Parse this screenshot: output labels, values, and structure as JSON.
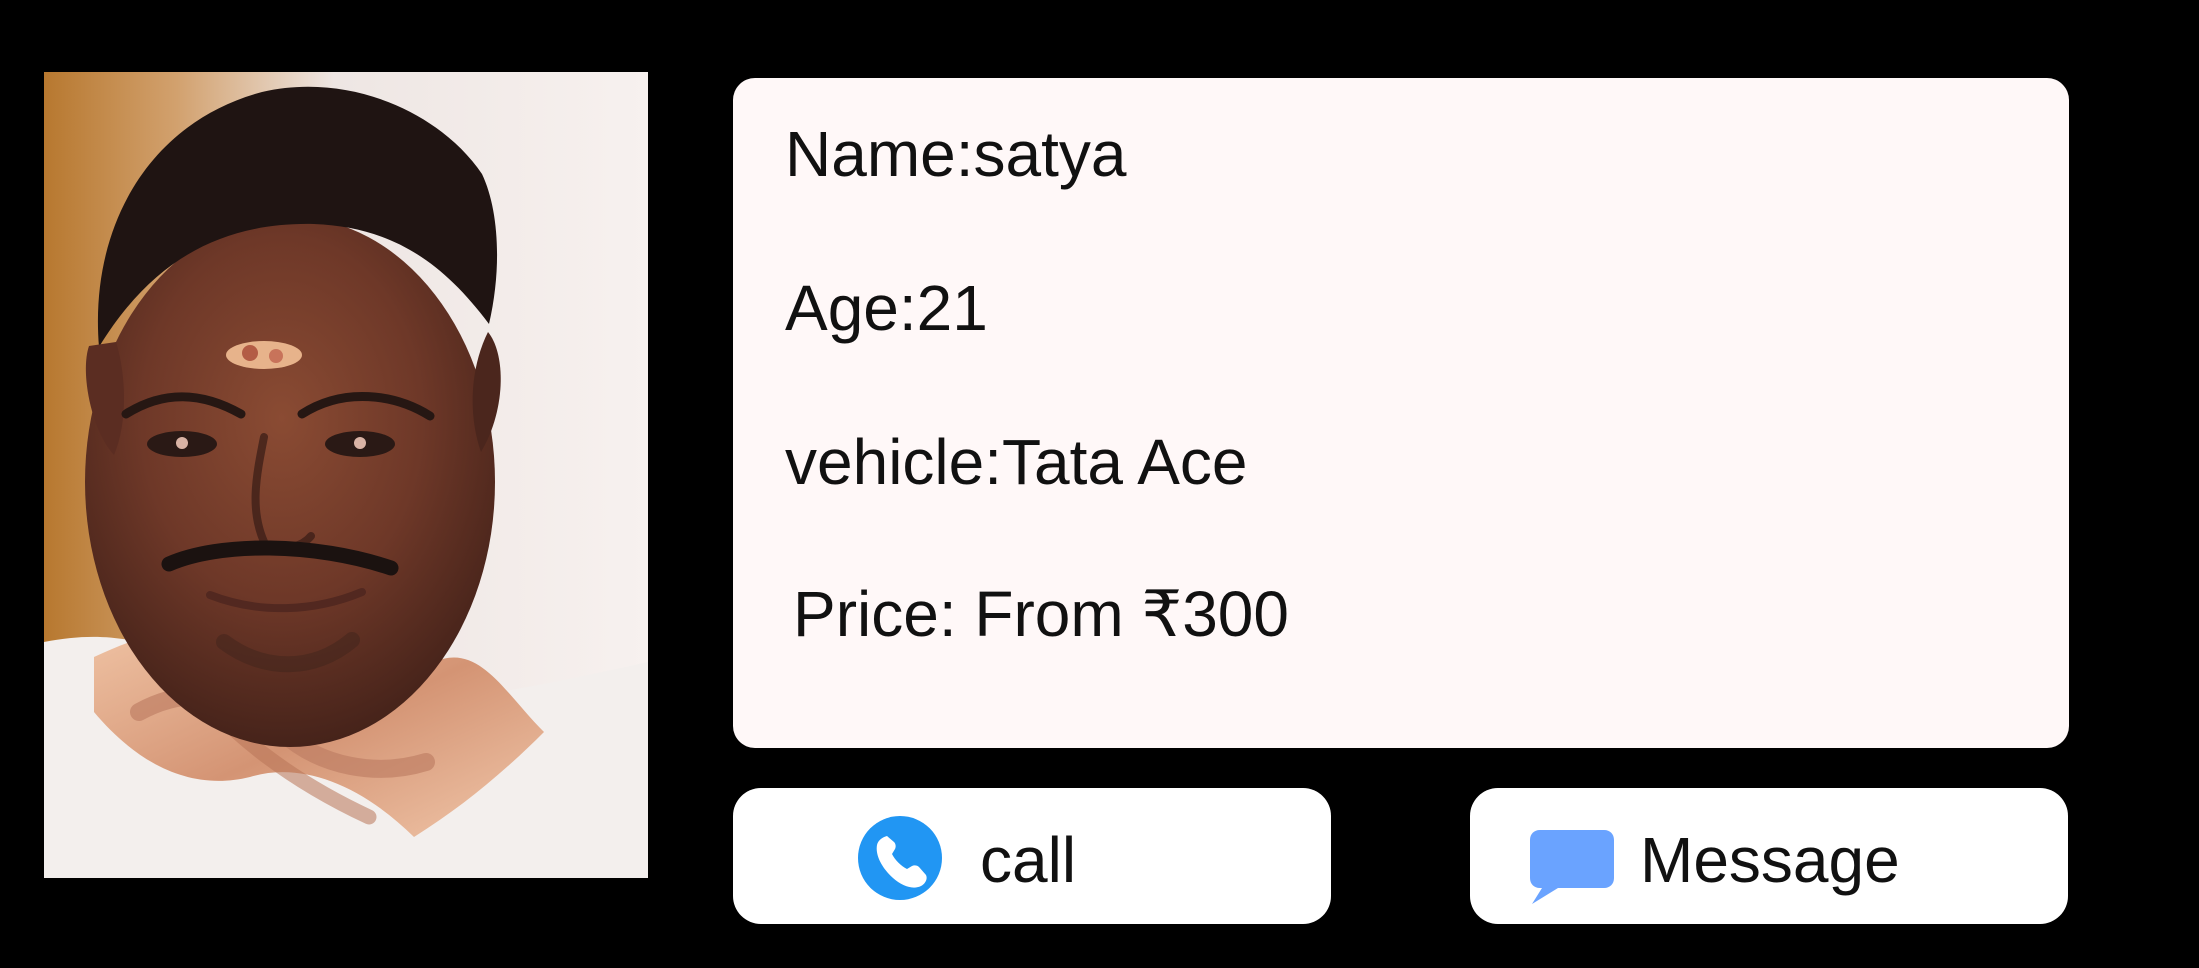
{
  "profile": {
    "photo_alt": "Driver portrait",
    "name": "Name:satya",
    "age": "Age:21",
    "vehicle": "vehicle:Tata Ace",
    "price": "Price: From ₹300"
  },
  "actions": {
    "call_label": "call",
    "message_label": "Message"
  },
  "icons": {
    "call": "phone-icon",
    "message": "chat-bubble-icon"
  },
  "colors": {
    "background": "#000000",
    "card_background": "#fff8f8",
    "button_background": "#ffffff",
    "call_icon": "#2196f3",
    "message_icon": "#6aa3ff",
    "text": "#111111"
  }
}
